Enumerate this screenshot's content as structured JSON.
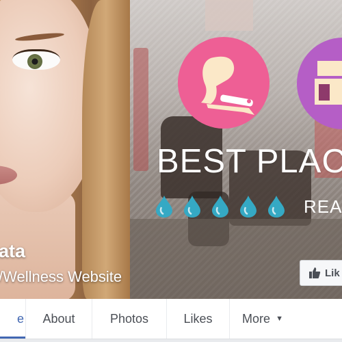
{
  "cover": {
    "headline": "BEST PLACE",
    "tagline": "REAL",
    "icons": [
      "hair-styling-icon",
      "makeup-icon",
      "water-drop-icon"
    ],
    "drop_count": 5
  },
  "page": {
    "name": "ata",
    "category": "/Wellness Website"
  },
  "actions": {
    "like_label": "Lik"
  },
  "nav": {
    "tabs": [
      {
        "label": "e",
        "active": true
      },
      {
        "label": "About",
        "active": false
      },
      {
        "label": "Photos",
        "active": false
      },
      {
        "label": "Likes",
        "active": false
      },
      {
        "label": "More",
        "active": false
      }
    ]
  },
  "colors": {
    "accent": "#4267b2",
    "hair_icon_bg": "#ee5f95",
    "makeup_icon_bg": "#b55ec6",
    "drop": "#35a9c4"
  }
}
